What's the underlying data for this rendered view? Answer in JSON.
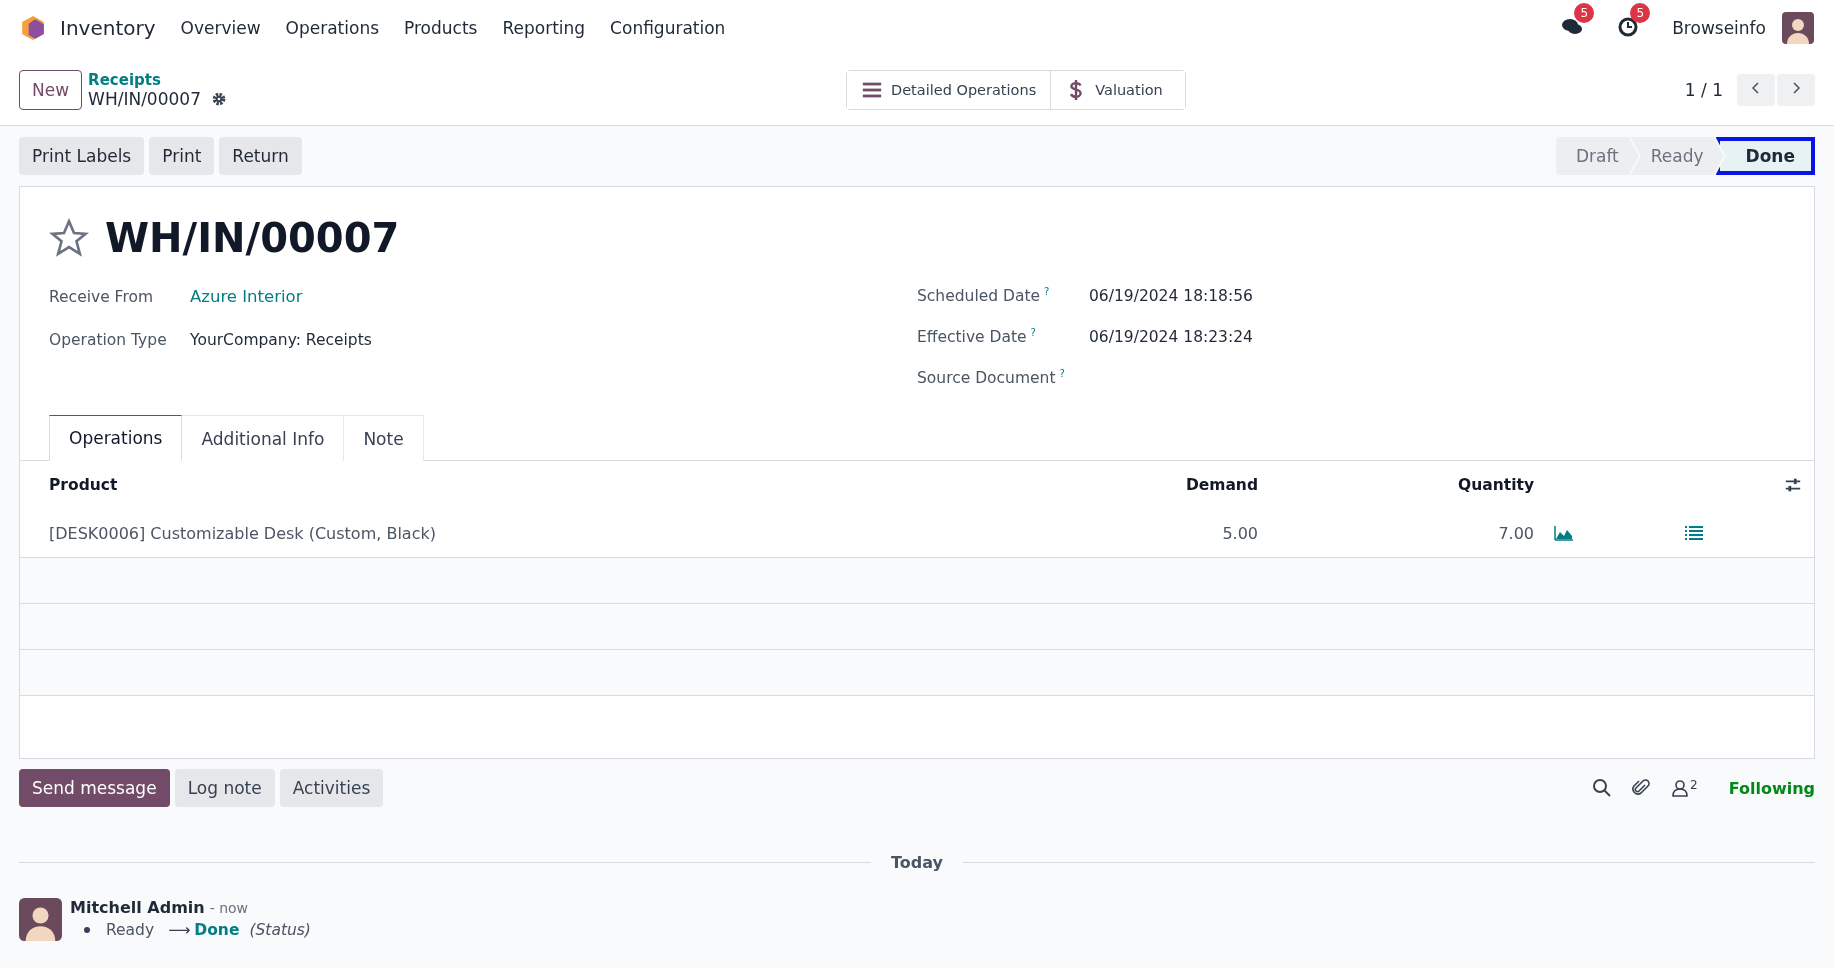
{
  "navbar": {
    "app_name": "Inventory",
    "menu": [
      "Overview",
      "Operations",
      "Products",
      "Reporting",
      "Configuration"
    ],
    "messages_badge": "5",
    "activities_badge": "5",
    "company": "Browseinfo"
  },
  "control_panel": {
    "new_button": "New",
    "breadcrumb": "Receipts",
    "record_name": "WH/IN/00007",
    "smart_buttons": [
      {
        "kind": "list",
        "label": "Detailed Operations"
      },
      {
        "kind": "dollar",
        "label": "Valuation"
      }
    ],
    "pager": "1 / 1"
  },
  "actions": [
    "Print Labels",
    "Print",
    "Return"
  ],
  "stages": [
    {
      "label": "Draft",
      "selected": false,
      "highlighted": false
    },
    {
      "label": "Ready",
      "selected": false,
      "highlighted": false
    },
    {
      "label": "Done",
      "selected": true,
      "highlighted": true
    }
  ],
  "form": {
    "title": "WH/IN/00007",
    "starred": false,
    "left_fields": [
      {
        "label": "Receive From",
        "value": "Azure Interior",
        "kind": "link"
      },
      {
        "label": "Operation Type",
        "value": "YourCompany: Receipts",
        "kind": "text"
      }
    ],
    "right_fields": [
      {
        "label": "Scheduled Date",
        "help": "?",
        "value": "06/19/2024 18:18:56"
      },
      {
        "label": "Effective Date",
        "help": "?",
        "value": "06/19/2024 18:23:24"
      },
      {
        "label": "Source Document",
        "help": "?"
      }
    ]
  },
  "tabs": [
    {
      "label": "Operations",
      "selected": true
    },
    {
      "label": "Additional Info",
      "selected": false
    },
    {
      "label": "Note",
      "selected": false
    }
  ],
  "table": {
    "columns": [
      "Product",
      "Demand",
      "Quantity"
    ],
    "rows": [
      {
        "product": "[DESK0006] Customizable Desk (Custom, Black)",
        "demand": "5.00",
        "quantity": "7.00"
      }
    ]
  },
  "chatter": {
    "buttons": [
      {
        "label": "Send message",
        "selected": true
      },
      {
        "label": "Log note",
        "selected": false
      },
      {
        "label": "Activities",
        "selected": false
      }
    ],
    "followers_count": "2",
    "following": "Following",
    "separator": "Today",
    "messages": [
      {
        "author": "Mitchell Admin",
        "time": "- now",
        "old_value": "Ready",
        "arrow": "⟶",
        "new_value": "Done",
        "field": "(Status)"
      }
    ]
  }
}
